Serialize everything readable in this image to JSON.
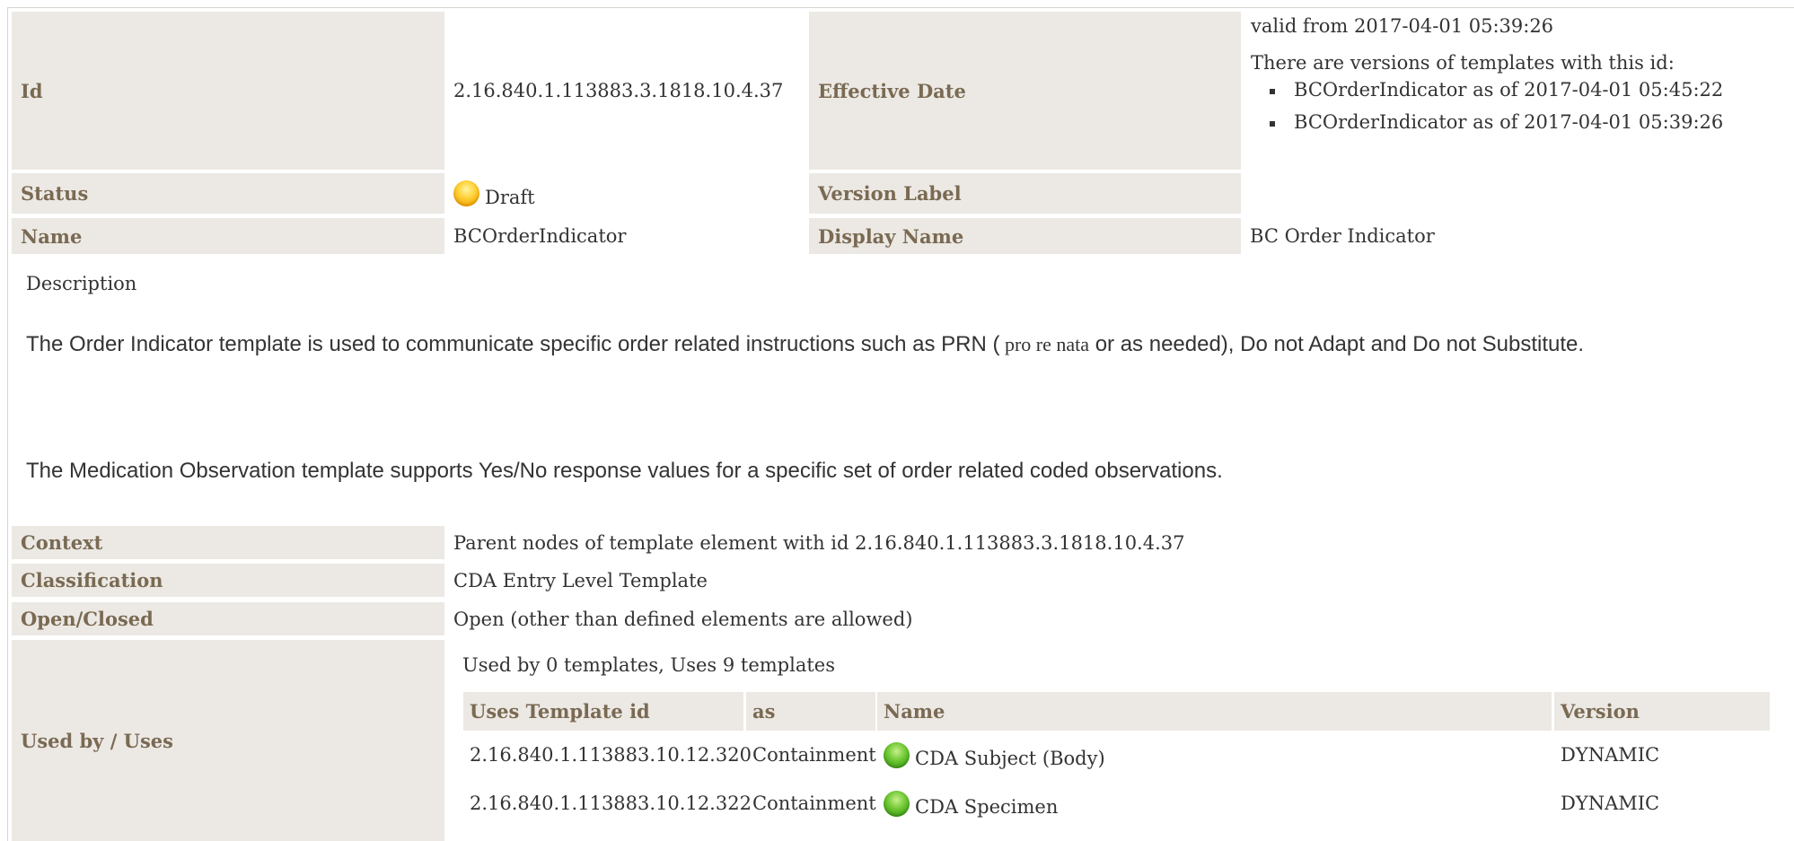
{
  "template": {
    "id_label": "Id",
    "id_value": "2.16.840.1.113883.3.1818.10.4.37",
    "effective_date_label": "Effective Date",
    "effective_date_value": "valid from 2017-04-01 05:39:26",
    "versions_intro": "There are versions of templates with this id:",
    "versions": [
      "BCOrderIndicator as of 2017-04-01 05:45:22",
      "BCOrderIndicator as of 2017-04-01 05:39:26"
    ],
    "status_label": "Status",
    "status_value": "Draft",
    "status_icon": "yellow-orb-icon",
    "version_label_label": "Version Label",
    "version_label_value": "",
    "name_label": "Name",
    "name_value": "BCOrderIndicator",
    "display_name_label": "Display Name",
    "display_name_value": "BC Order Indicator"
  },
  "description": {
    "label": "Description",
    "paragraph1_before": "The Order Indicator template is used to communicate specific order related instructions such as PRN (",
    "paragraph1_italic": " pro re nata",
    "paragraph1_after": " or as needed), Do not Adapt and Do not Substitute.",
    "paragraph2": "The Medication Observation template supports Yes/No response values for a specific set of order related coded observations."
  },
  "details": {
    "context_label": "Context",
    "context_value": "Parent nodes of template element with id 2.16.840.1.113883.3.1818.10.4.37",
    "classification_label": "Classification",
    "classification_value": "CDA Entry Level Template",
    "open_closed_label": "Open/Closed",
    "open_closed_value": "Open (other than defined elements are allowed)",
    "used_by_label": "Used by / Uses",
    "used_by_summary": "Used by 0 templates, Uses 9 templates"
  },
  "uses_table": {
    "headers": [
      "Uses Template id",
      "as",
      "Name",
      "Version"
    ],
    "rows": [
      {
        "template_id": "2.16.840.1.113883.10.12.320",
        "as": "Containment",
        "name": "CDA Subject (Body)",
        "version": "DYNAMIC",
        "icon": "green-orb-icon"
      },
      {
        "template_id": "2.16.840.1.113883.10.12.322",
        "as": "Containment",
        "name": "CDA Specimen",
        "version": "DYNAMIC",
        "icon": "green-orb-icon"
      }
    ]
  },
  "colors": {
    "label_bg": "#ece9e4",
    "label_text": "#7a6a53",
    "status_draft": "#ffd23a",
    "status_active": "#6cc631"
  }
}
